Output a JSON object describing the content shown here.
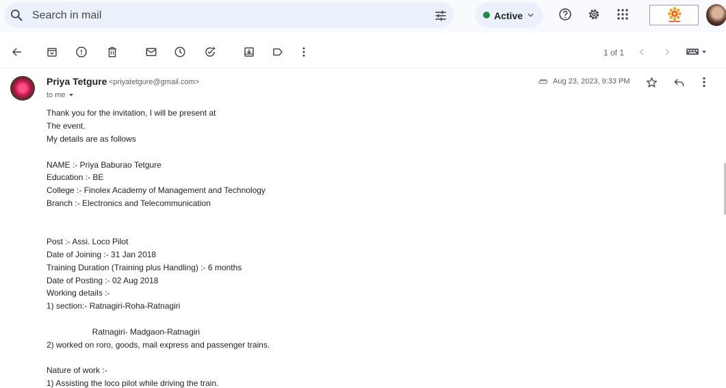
{
  "header": {
    "search_placeholder": "Search in mail",
    "status_label": "Active",
    "accent_color": "#1e8e3e"
  },
  "toolbar": {
    "icons": [
      "back-arrow-icon",
      "archive-icon",
      "report-spam-icon",
      "delete-icon",
      "mark-unread-icon",
      "snooze-icon",
      "add-task-icon",
      "move-to-icon",
      "label-icon",
      "more-vert-icon"
    ],
    "pager": "1 of 1"
  },
  "message": {
    "sender_name": "Priya Tetgure",
    "sender_email": "<priyatetgure@gmail.com>",
    "to_label": "to me",
    "date": "Aug 23, 2023, 9:33 PM",
    "body": [
      "Thank you for the invitation, I will be present at",
      "The event.",
      "My details are as follows",
      "",
      "NAME :- Priya Baburao Tetgure",
      "Education :- BE",
      "College :- Finolex Academy of Management and Technology",
      "Branch :- Electronics and Telecommunication",
      "",
      "",
      "Post :- Assi. Loco Pilot",
      "Date of Joining :- 31 Jan 2018",
      "Training Duration (Training plus Handling) :- 6 months",
      "Date of Posting :- 02 Aug 2018",
      "Working details :-",
      "1) section:- Ratnagiri-Roha-Ratnagiri",
      "",
      "                    Ratnagiri- Madgaon-Ratnagiri",
      "2) worked on roro, goods, mail express and passenger trains.",
      "",
      "Nature of work :-",
      "1) Assisting the loco pilot while driving the train."
    ]
  }
}
